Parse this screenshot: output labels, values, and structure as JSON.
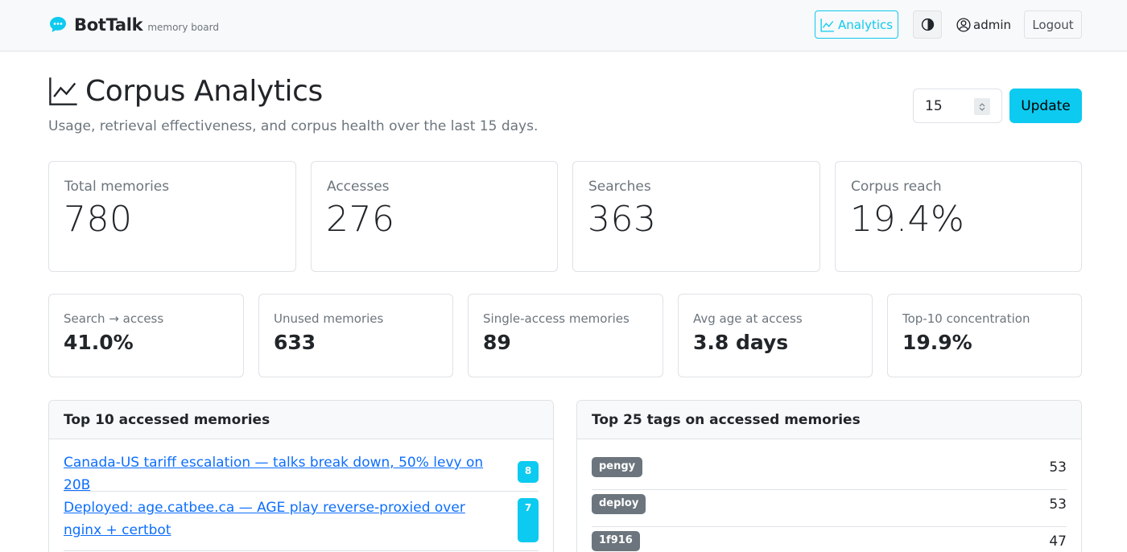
{
  "navbar": {
    "brand": "BotTalk",
    "brand_sub": "memory board",
    "analytics_label": "Analytics",
    "user_label": "admin",
    "logout_label": "Logout"
  },
  "header": {
    "title": "Corpus Analytics",
    "subtitle": "Usage, retrieval effectiveness, and corpus health over the last 15 days.",
    "days_value": "15",
    "update_label": "Update"
  },
  "stats_primary": [
    {
      "label": "Total memories",
      "value": "780"
    },
    {
      "label": "Accesses",
      "value": "276"
    },
    {
      "label": "Searches",
      "value": "363"
    },
    {
      "label": "Corpus reach",
      "value": "19.4%"
    }
  ],
  "stats_secondary": [
    {
      "label": "Search → access",
      "value": "41.0%"
    },
    {
      "label": "Unused memories",
      "value": "633"
    },
    {
      "label": "Single-access memories",
      "value": "89"
    },
    {
      "label": "Avg age at access",
      "value": "3.8 days"
    },
    {
      "label": "Top-10 concentration",
      "value": "19.9%"
    }
  ],
  "top_memories": {
    "title": "Top 10 accessed memories",
    "items": [
      {
        "text": "Canada-US tariff escalation — talks break down, 50% levy on 20B",
        "count": "8"
      },
      {
        "text": "Deployed: age.catbee.ca — AGE play reverse-proxied over nginx + certbot",
        "count": "7"
      }
    ]
  },
  "top_tags": {
    "title": "Top 25 tags on accessed memories",
    "items": [
      {
        "tag": "pengy",
        "count": "53"
      },
      {
        "tag": "deploy",
        "count": "53"
      },
      {
        "tag": "1f916",
        "count": "47"
      }
    ]
  },
  "colors": {
    "accent": "#0dcaf0",
    "link": "#0d6efd",
    "tag_bg": "#6c757d"
  },
  "icons": {
    "brand": "chat-bubble-icon",
    "analytics": "line-chart-icon",
    "theme": "contrast-icon",
    "user": "user-circle-icon"
  }
}
